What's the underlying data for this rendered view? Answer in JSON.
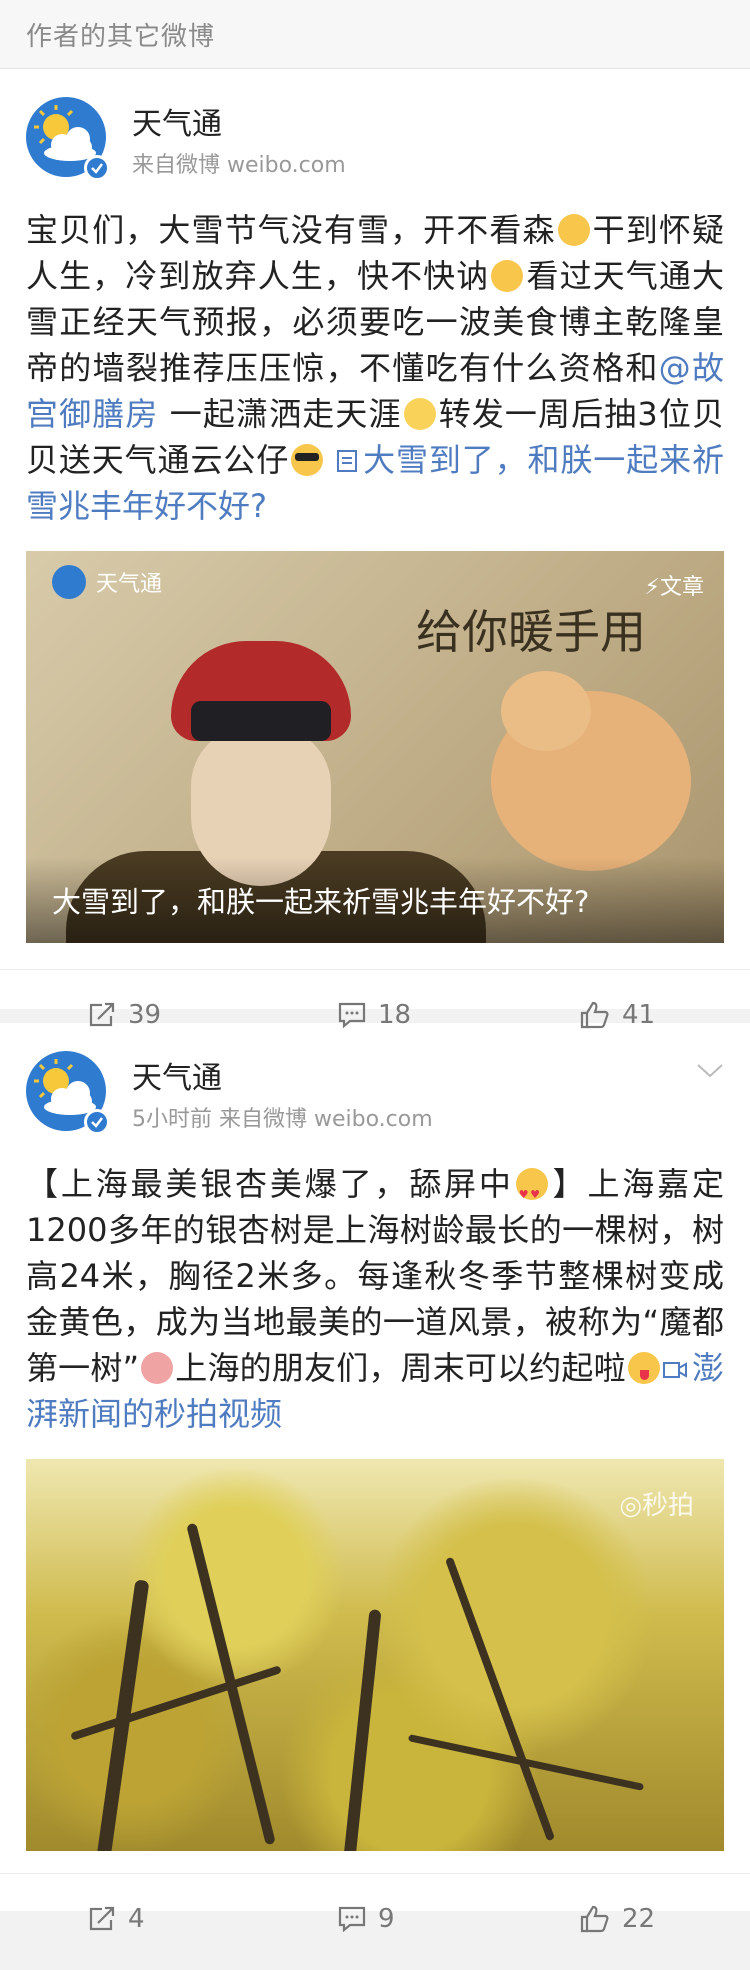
{
  "section_title": "作者的其它微博",
  "posts": [
    {
      "author": "天气通",
      "meta": "来自微博 weibo.com",
      "text": {
        "p1": "宝贝们，大雪节气没有雪，开不看森",
        "p2": "干到怀疑人生，冷到放弃人生，快不快讷",
        "p3": "看过天气通大雪正经天气预报，必须要吃一波美食博主乾隆皇帝的墙裂推荐压压惊，不懂吃有什么资格和",
        "mention": "@故宫御膳房",
        "p4": " 一起潇洒走天涯",
        "p5": "转发一周后抽3位贝贝送天气通云公仔",
        "link": "大雪到了，和朕一起来祈雪兆丰年好不好?"
      },
      "card": {
        "brand": "天气通",
        "type_label": "⚡文章",
        "handwriting": "给你暖手用",
        "title": "大雪到了，和朕一起来祈雪兆丰年好不好?"
      },
      "actions": {
        "repost": "39",
        "comment": "18",
        "like": "41"
      }
    },
    {
      "author": "天气通",
      "meta": "5小时前  来自微博 weibo.com",
      "text": {
        "p1": "【上海最美银杏美爆了，舔屏中",
        "p2": "】上海嘉定1200多年的银杏树是上海树龄最长的一棵树，树高24米，胸径2米多。每逢秋冬季节整棵树变成金黄色，成为当地最美的一道风景，被称为“魔都第一树”",
        "p3": "上海的朋友们，周末可以约起啦",
        "link": "澎湃新闻的秒拍视频"
      },
      "video": {
        "watermark": "◎秒拍"
      },
      "actions": {
        "repost": "4",
        "comment": "9",
        "like": "22"
      }
    }
  ],
  "icons": {
    "avatar": "weather-sun-cloud-icon",
    "verified": "verified-badge-icon",
    "chevron": "chevron-down-icon",
    "repost": "repost-icon",
    "comment": "comment-icon",
    "like": "thumbs-up-icon",
    "article_link": "article-icon",
    "video_link": "video-icon"
  },
  "colors": {
    "link": "#4f7cc0",
    "brand_blue": "#2f7bd0",
    "background": "#f2f2f2"
  }
}
